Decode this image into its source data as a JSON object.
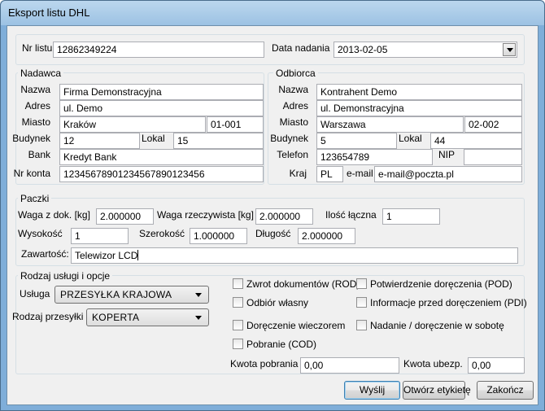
{
  "window": {
    "title": "Eksport listu DHL"
  },
  "top": {
    "nr_listu_label": "Nr listu",
    "nr_listu_value": "12862349224",
    "data_nadania_label": "Data nadania",
    "data_nadania_value": "2013-02-05"
  },
  "nadawca": {
    "group_label": "Nadawca",
    "nazwa_label": "Nazwa",
    "nazwa_value": "Firma Demonstracyjna",
    "adres_label": "Adres",
    "adres_value": "ul. Demo",
    "miasto_label": "Miasto",
    "miasto_value": "Kraków",
    "kod_value": "01-001",
    "budynek_label": "Budynek",
    "budynek_value": "12",
    "lokal_label": "Lokal",
    "lokal_value": "15",
    "bank_label": "Bank",
    "bank_value": "Kredyt Bank",
    "nr_konta_label": "Nr konta",
    "nr_konta_value": "12345678901234567890123456"
  },
  "odbiorca": {
    "group_label": "Odbiorca",
    "nazwa_label": "Nazwa",
    "nazwa_value": "Kontrahent Demo",
    "adres_label": "Adres",
    "adres_value": "ul. Demonstracyjna",
    "miasto_label": "Miasto",
    "miasto_value": "Warszawa",
    "kod_value": "02-002",
    "budynek_label": "Budynek",
    "budynek_value": "5",
    "lokal_label": "Lokal",
    "lokal_value": "44",
    "telefon_label": "Telefon",
    "telefon_value": "123654789",
    "nip_label": "NIP",
    "nip_value": "",
    "kraj_label": "Kraj",
    "kraj_value": "PL",
    "email_label": "e-mail",
    "email_value": "e-mail@poczta.pl"
  },
  "paczki": {
    "group_label": "Paczki",
    "waga_dok_label": "Waga z dok. [kg]",
    "waga_dok_value": "2.000000",
    "waga_rzecz_label": "Waga rzeczywista [kg]",
    "waga_rzecz_value": "2.000000",
    "ilosc_label": "Ilość łączna",
    "ilosc_value": "1",
    "wysokosc_label": "Wysokość",
    "wysokosc_value": "1",
    "szerokosc_label": "Szerokość",
    "szerokosc_value": "1.000000",
    "dlugosc_label": "Długość",
    "dlugosc_value": "2.000000",
    "zawartosc_label": "Zawartość:",
    "zawartosc_value": "Telewizor LCD"
  },
  "uslugi": {
    "group_label": "Rodzaj usługi i opcje",
    "usluga_label": "Usługa",
    "usluga_value": "PRZESYŁKA KRAJOWA",
    "przesylka_label": "Rodzaj przesyłki",
    "przesylka_value": "KOPERTA",
    "options": {
      "rod": "Zwrot dokumentów (ROD)",
      "pod": "Potwierdzenie doręczenia (POD)",
      "odbior": "Odbiór własny",
      "pdi": "Informacje przed doręczeniem (PDI)",
      "wieczorem": "Doręczenie wieczorem",
      "sobota": "Nadanie / doręczenie w sobotę",
      "cod": "Pobranie (COD)"
    },
    "kwota_pobrania_label": "Kwota pobrania",
    "kwota_pobrania_value": "0,00",
    "kwota_ubezp_label": "Kwota ubezp.",
    "kwota_ubezp_value": "0,00"
  },
  "buttons": {
    "wyslij": "Wyślij",
    "otworz": "Otwórz etykietę",
    "zakoncz": "Zakończ"
  }
}
